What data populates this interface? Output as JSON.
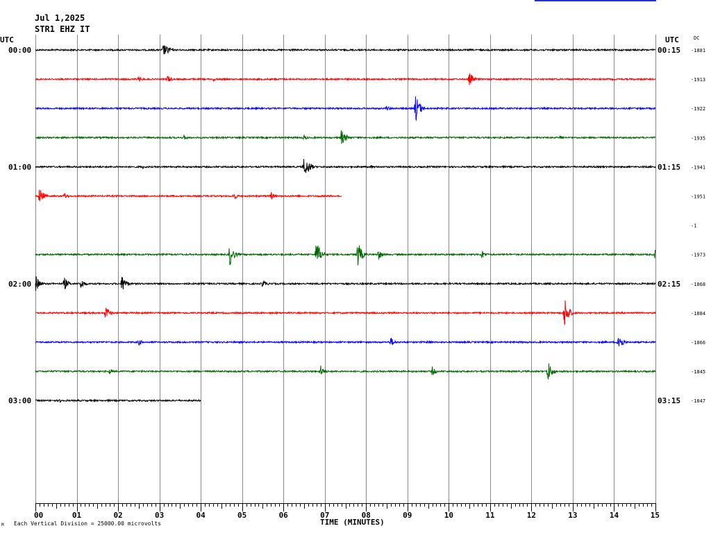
{
  "header": {
    "date": "Jul 1,2025",
    "station": "STR1 EHZ IT"
  },
  "axis": {
    "left_label": "UTC",
    "right_label": "UTC",
    "dc_label": "DC",
    "xlabel": "TIME (MINUTES)"
  },
  "footer": {
    "note": "Each Vertical Division = 25000.00 microvolts",
    "marker": "M"
  },
  "colors": {
    "black": "#000000",
    "red": "#ff0000",
    "blue": "#0000ff",
    "green": "#006600",
    "grid": "#888888",
    "topline": "#2233cc"
  },
  "chart_data": {
    "type": "line",
    "title": "",
    "xlim": [
      0,
      15
    ],
    "x_ticks": [
      "00",
      "01",
      "02",
      "03",
      "04",
      "05",
      "06",
      "07",
      "08",
      "09",
      "10",
      "11",
      "12",
      "13",
      "14",
      "15"
    ],
    "rows": [
      {
        "left": "00:00",
        "right": "00:15",
        "dc": "-1881",
        "color": "black",
        "end_minute": 15,
        "events": [
          [
            3.1,
            10
          ],
          [
            3.2,
            7
          ]
        ]
      },
      {
        "left": "",
        "right": "",
        "dc": "-1913",
        "color": "red",
        "end_minute": 15,
        "events": [
          [
            2.5,
            5
          ],
          [
            3.2,
            6
          ],
          [
            4.3,
            3
          ],
          [
            10.5,
            10
          ]
        ]
      },
      {
        "left": "",
        "right": "",
        "dc": "-1922",
        "color": "blue",
        "end_minute": 15,
        "events": [
          [
            8.5,
            4
          ],
          [
            9.2,
            22
          ],
          [
            9.3,
            8
          ]
        ]
      },
      {
        "left": "",
        "right": "",
        "dc": "-1935",
        "color": "green",
        "end_minute": 15,
        "events": [
          [
            3.6,
            4
          ],
          [
            6.5,
            4
          ],
          [
            7.4,
            12
          ],
          [
            7.5,
            6
          ],
          [
            12.7,
            4
          ]
        ]
      },
      {
        "left": "01:00",
        "right": "01:15",
        "dc": "-1941",
        "color": "black",
        "end_minute": 15,
        "events": [
          [
            2.6,
            3
          ],
          [
            6.5,
            16
          ],
          [
            6.6,
            10
          ],
          [
            8.1,
            3
          ]
        ]
      },
      {
        "left": "",
        "right": "",
        "dc": "-1951",
        "color": "red",
        "end_minute": 7.4,
        "events": [
          [
            0.1,
            13
          ],
          [
            0.7,
            5
          ],
          [
            4.8,
            6
          ],
          [
            5.7,
            6
          ]
        ]
      },
      {
        "left": "",
        "right": "",
        "dc": "-1",
        "color": "blue",
        "end_minute": 0,
        "events": []
      },
      {
        "left": "",
        "right": "",
        "dc": "-1973",
        "color": "green",
        "end_minute": 15,
        "events": [
          [
            4.7,
            18
          ],
          [
            6.8,
            22
          ],
          [
            7.8,
            20
          ],
          [
            8.3,
            8
          ],
          [
            10.8,
            7
          ],
          [
            15.0,
            12
          ]
        ]
      },
      {
        "left": "02:00",
        "right": "02:15",
        "dc": "-1868",
        "color": "black",
        "end_minute": 15,
        "events": [
          [
            0.0,
            14
          ],
          [
            0.7,
            10
          ],
          [
            1.1,
            8
          ],
          [
            2.1,
            14
          ],
          [
            5.5,
            7
          ]
        ]
      },
      {
        "left": "",
        "right": "",
        "dc": "-1884",
        "color": "red",
        "end_minute": 15,
        "events": [
          [
            1.7,
            11
          ],
          [
            12.8,
            25
          ]
        ]
      },
      {
        "left": "",
        "right": "",
        "dc": "-1866",
        "color": "blue",
        "end_minute": 15,
        "events": [
          [
            2.5,
            5
          ],
          [
            8.6,
            7
          ],
          [
            9.5,
            4
          ],
          [
            14.1,
            16
          ]
        ]
      },
      {
        "left": "",
        "right": "",
        "dc": "-1845",
        "color": "green",
        "end_minute": 15,
        "events": [
          [
            1.8,
            4
          ],
          [
            6.9,
            9
          ],
          [
            9.6,
            7
          ],
          [
            12.4,
            16
          ]
        ]
      },
      {
        "left": "03:00",
        "right": "03:15",
        "dc": "-1847",
        "color": "black",
        "end_minute": 4.0,
        "events": [
          [
            0.6,
            3
          ]
        ]
      }
    ]
  }
}
